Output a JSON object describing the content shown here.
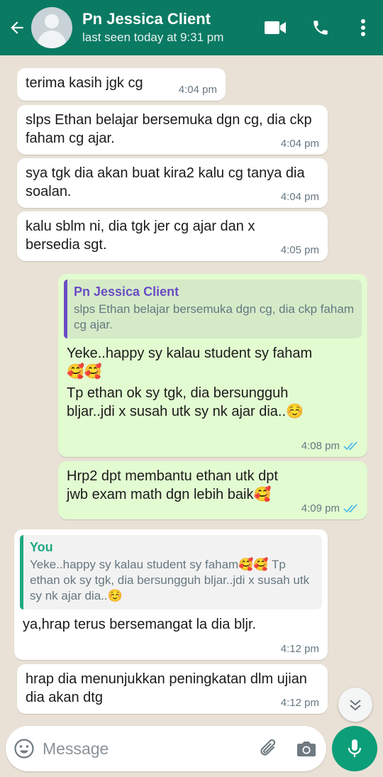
{
  "header": {
    "contact_name": "Pn Jessica Client",
    "last_seen": "last seen today at 9:31 pm"
  },
  "messages": [
    {
      "direction": "in",
      "text": "terima kasih jgk cg",
      "time": "4:04 pm"
    },
    {
      "direction": "in",
      "text": "slps Ethan belajar bersemuka dgn cg, dia ckp faham cg ajar.",
      "time": "4:04 pm"
    },
    {
      "direction": "in",
      "text": "sya tgk dia akan buat kira2 kalu cg tanya dia soalan.",
      "time": "4:04 pm"
    },
    {
      "direction": "in",
      "text": "kalu sblm ni, dia tgk jer cg ajar dan x bersedia sgt.",
      "time": "4:05 pm"
    },
    {
      "direction": "out",
      "quote_author": "Pn Jessica Client",
      "quote_text": "slps Ethan belajar bersemuka dgn cg, dia ckp faham cg ajar.",
      "text_line1": "Yeke..happy sy kalau student sy faham",
      "emoji_line": "🥰🥰",
      "text_line2": "Tp ethan ok sy tgk, dia bersungguh bljar..jdi x susah utk sy nk ajar dia..☺️",
      "time": "4:08 pm"
    },
    {
      "direction": "out",
      "text": "Hrp2 dpt membantu ethan utk dpt jwb exam math dgn lebih baik🥰",
      "time": "4:09 pm"
    },
    {
      "direction": "in",
      "quote_author": "You",
      "quote_text": "Yeke..happy sy kalau student sy faham🥰🥰 Tp ethan ok sy tgk, dia bersungguh bljar..jdi x susah utk sy nk ajar dia..☺️",
      "text": "ya,hrap terus bersemangat la dia bljr.",
      "time": "4:12 pm"
    },
    {
      "direction": "in",
      "text": "hrap dia menunjukkan peningkatan dlm ujian dia akan dtg",
      "time": "4:12 pm"
    }
  ],
  "composer": {
    "placeholder": "Message"
  },
  "colors": {
    "header_bg": "#0b7a63",
    "outgoing_bubble": "#e2fbd1",
    "incoming_bubble": "#ffffff",
    "read_ticks": "#53bdeb",
    "mic_button": "#0b9e78"
  },
  "icons": [
    "back-arrow-icon",
    "avatar",
    "video-call-icon",
    "phone-icon",
    "more-vert-icon",
    "read-ticks-icon",
    "scroll-down-icon",
    "emoji-icon",
    "attach-icon",
    "camera-icon",
    "mic-icon"
  ]
}
